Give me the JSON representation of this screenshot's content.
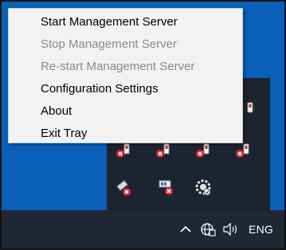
{
  "context_menu": {
    "items": [
      {
        "label": "Start Management Server",
        "enabled": true
      },
      {
        "label": "Stop Management Server",
        "enabled": false
      },
      {
        "label": "Re-start Management Server",
        "enabled": false
      },
      {
        "label": "Configuration Settings",
        "enabled": true
      },
      {
        "label": "About",
        "enabled": true
      },
      {
        "label": "Exit Tray",
        "enabled": true
      }
    ]
  },
  "taskbar": {
    "language": "ENG",
    "icons": [
      "chevron-up-icon",
      "network-globe-icon",
      "speaker-icon"
    ]
  },
  "tray_flyout": {
    "icons": [
      "removable-drive-error-icon",
      "removable-drive-error-icon",
      "removable-drive-error-icon",
      "removable-drive-error-icon",
      "removable-drive-error-icon",
      "security-shield-error-icon",
      "network-card-error-icon",
      "management-server-gear-icon"
    ]
  },
  "colors": {
    "desktop_blue": "#0a5fb8",
    "taskbar": "#1f2735",
    "menu_background": "#f2f2f2",
    "disabled_text": "#8a8a8a",
    "error_red": "#d9262c"
  }
}
